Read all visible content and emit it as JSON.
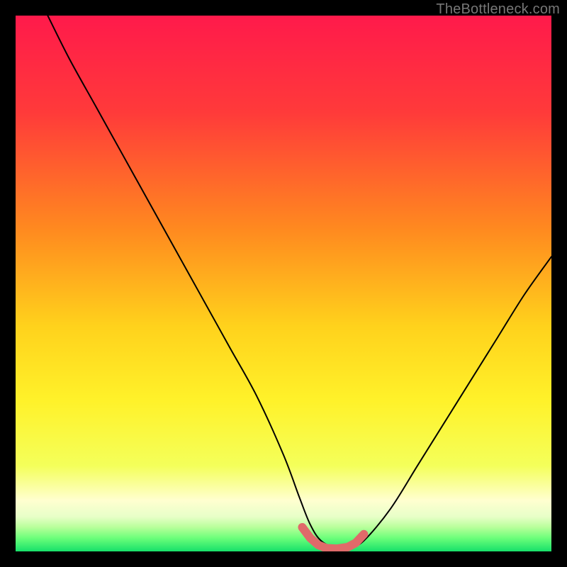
{
  "watermark": "TheBottleneck.com",
  "colors": {
    "frame": "#000000",
    "gradient_stops": [
      {
        "offset": 0.0,
        "color": "#ff1a4b"
      },
      {
        "offset": 0.18,
        "color": "#ff3a3a"
      },
      {
        "offset": 0.4,
        "color": "#ff8a1f"
      },
      {
        "offset": 0.58,
        "color": "#ffd21c"
      },
      {
        "offset": 0.72,
        "color": "#fff22a"
      },
      {
        "offset": 0.84,
        "color": "#f4ff5a"
      },
      {
        "offset": 0.905,
        "color": "#ffffd0"
      },
      {
        "offset": 0.935,
        "color": "#e8ffc8"
      },
      {
        "offset": 0.955,
        "color": "#b8ff9a"
      },
      {
        "offset": 0.975,
        "color": "#6cff7a"
      },
      {
        "offset": 1.0,
        "color": "#17e06a"
      }
    ],
    "curve": "#000000",
    "marker": "#e06a6a"
  },
  "chart_data": {
    "type": "line",
    "title": "",
    "xlabel": "",
    "ylabel": "",
    "xlim": [
      0,
      100
    ],
    "ylim": [
      0,
      100
    ],
    "grid": false,
    "series": [
      {
        "name": "bottleneck-curve",
        "x": [
          6,
          10,
          15,
          20,
          25,
          30,
          35,
          40,
          45,
          50,
          53,
          55,
          57,
          60,
          62,
          65,
          70,
          75,
          80,
          85,
          90,
          95,
          100
        ],
        "y": [
          100,
          92,
          83,
          74,
          65,
          56,
          47,
          38,
          29,
          18,
          10,
          5,
          2,
          0.5,
          0.5,
          2,
          8,
          16,
          24,
          32,
          40,
          48,
          55
        ]
      }
    ],
    "annotations": [
      {
        "name": "valley-marker",
        "type": "path",
        "x": [
          53.5,
          55,
          56.5,
          58,
          60,
          62,
          63.5,
          65
        ],
        "y": [
          4.5,
          2.5,
          1.2,
          0.6,
          0.5,
          0.8,
          1.6,
          3.2
        ]
      }
    ]
  }
}
